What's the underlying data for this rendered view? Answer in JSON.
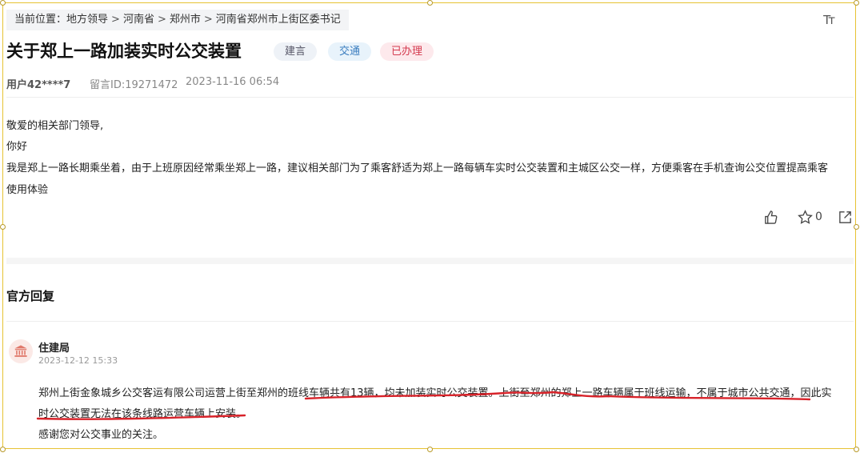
{
  "breadcrumb": {
    "prefix": "当前位置：",
    "items": [
      "地方领导",
      "河南省",
      "郑州市",
      "河南省郑州市上街区委书记"
    ],
    "separator": ">"
  },
  "toolbar": {
    "font_size_icon": "Tт"
  },
  "post": {
    "title": "关于郑上一路加装实时公交装置",
    "tags": [
      "建言",
      "交通",
      "已办理"
    ],
    "user": "用户42****7",
    "message_id": "留言ID:19271472",
    "time": "2023-11-16 06:54",
    "body_lines": [
      "敬爱的相关部门领导,",
      "你好",
      "我是郑上一路长期乘坐着，由于上班原因经常乘坐郑上一路，建议相关部门为了乘客舒适为郑上一路每辆车实时公交装置和主城区公交一样，方便乘客在手机查询公交位置提高乘客",
      "使用体验"
    ],
    "favorite_count": "0"
  },
  "reply": {
    "section_title": "官方回复",
    "department": "住建局",
    "time": "2023-12-12 15:33",
    "lines": [
      "郑州上街金象城乡公交客运有限公司运营上街至郑州的班线车辆共有13辆，均未加装实时公交装置。上街至郑州的郑上一路车辆属于班线运输，不属于城市公共交通，因此实",
      "时公交装置无法在该条线路运营车辆上安装。",
      "感谢您对公交事业的关注。"
    ]
  },
  "colors": {
    "frame": "#e7c233",
    "tag_suggest_bg": "#eef2f7",
    "tag_traffic_text": "#3a7dbf",
    "tag_done_text": "#d43a4f",
    "annotation_red": "#d8232a"
  }
}
